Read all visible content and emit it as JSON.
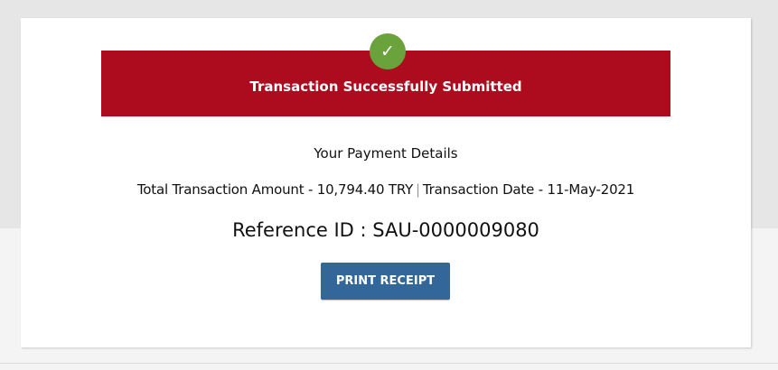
{
  "banner": {
    "icon": "check-icon",
    "icon_glyph": "✓",
    "title": "Transaction Successfully Submitted",
    "color": "#ad0c1f",
    "icon_color": "#6aa23b"
  },
  "details": {
    "title": "Your Payment Details",
    "amount_label": "Total Transaction Amount - 10,794.40 TRY",
    "separator": "|",
    "date_label": "Transaction Date - 11-May-2021",
    "reference": "Reference ID : SAU-0000009080"
  },
  "actions": {
    "print_label": "PRINT RECEIPT",
    "print_color": "#336699"
  }
}
